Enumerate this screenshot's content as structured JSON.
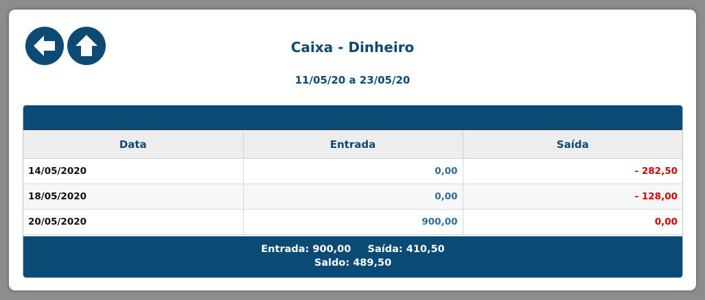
{
  "header": {
    "title": "Caixa - Dinheiro",
    "period": "11/05/20 a 23/05/20"
  },
  "nav": {
    "back_icon": "arrow-left-icon",
    "up_icon": "arrow-up-icon"
  },
  "colors": {
    "primary": "#0c4a76",
    "entrada": "#2b6ea3",
    "saida": "#e00000"
  },
  "table": {
    "columns": [
      "Data",
      "Entrada",
      "Saída"
    ],
    "rows": [
      {
        "data": "14/05/2020",
        "entrada": "0,00",
        "saida": "- 282,50"
      },
      {
        "data": "18/05/2020",
        "entrada": "0,00",
        "saida": "- 128,00"
      },
      {
        "data": "20/05/2020",
        "entrada": "900,00",
        "saida": "0,00"
      }
    ]
  },
  "summary": {
    "entrada_label": "Entrada:",
    "entrada_value": "900,00",
    "saida_label": "Saída:",
    "saida_value": "410,50",
    "saldo_label": "Saldo:",
    "saldo_value": "489,50"
  }
}
